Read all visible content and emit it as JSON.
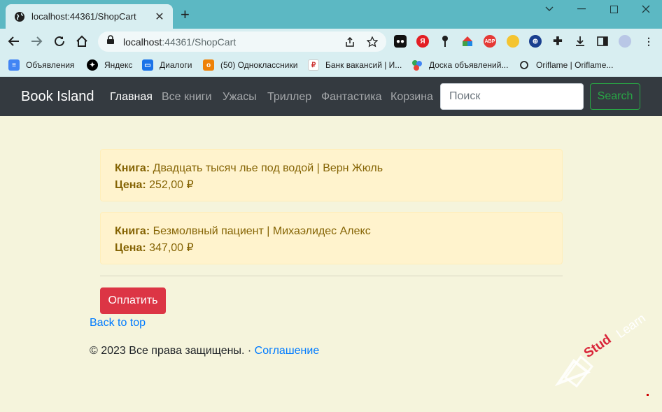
{
  "browser": {
    "tab_title": "localhost:44361/ShopCart",
    "url_host": "localhost",
    "url_rest": ":44361/ShopCart",
    "bookmarks": [
      {
        "label": "Объявления",
        "icon": "docs-icon",
        "color": "#4285f4"
      },
      {
        "label": "Яндекс",
        "icon": "yandex-star-icon",
        "color": "#000000"
      },
      {
        "label": "Диалоги",
        "icon": "chat-icon",
        "color": "#1a73e8"
      },
      {
        "label": "(50) Одноклассники",
        "icon": "ok-icon",
        "color": "#ee8208"
      },
      {
        "label": "Банк вакансий | И...",
        "icon": "jobs-icon",
        "color": "#888888"
      },
      {
        "label": "Доска объявлений...",
        "icon": "dots-icon",
        "color": "#34a853"
      },
      {
        "label": "Oriflame | Oriflame...",
        "icon": "oriflame-icon",
        "color": "#222222"
      }
    ]
  },
  "site": {
    "brand": "Book Island",
    "nav": [
      "Главная",
      "Все книги",
      "Ужасы",
      "Триллер",
      "Фантастика",
      "Корзина"
    ],
    "search_placeholder": "Поиск",
    "search_button": "Search"
  },
  "cart": {
    "book_label": "Книга:",
    "price_label": "Цена:",
    "items": [
      {
        "book": "Двадцать тысяч лье под водой | Верн Жюль",
        "price": "252,00 ₽"
      },
      {
        "book": "Безмолвный пациент | Михаэлидес Алекс",
        "price": "347,00 ₽"
      }
    ],
    "pay_button": "Оплатить"
  },
  "footer": {
    "back_to_top": "Back to top",
    "copyright": "© 2023 Все права защищены. · ",
    "agreement_link": "Соглашение"
  },
  "watermark": "Stud_Learn",
  "colors": {
    "navbar_bg": "#343a40",
    "page_bg": "#f5f4dc",
    "alert_bg": "#fff3cd",
    "alert_text": "#856404",
    "danger": "#dc3545",
    "success": "#28a745",
    "link": "#007bff"
  }
}
